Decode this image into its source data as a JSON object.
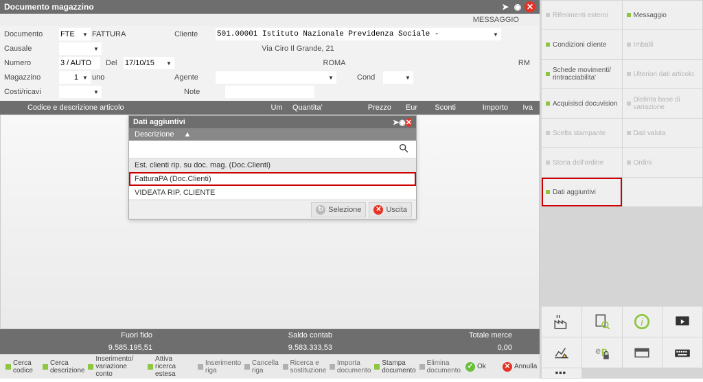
{
  "title": "Documento magazzino",
  "msg_label": "MESSAGGIO",
  "form": {
    "documento_lbl": "Documento",
    "documento_val": "FTE",
    "documento_desc": "FATTURA",
    "cliente_lbl": "Cliente",
    "cliente_val": "501.00001 Istituto Nazionale Previdenza Sociale -",
    "address": "Via Ciro Il Grande, 21",
    "city": "ROMA",
    "prov": "RM",
    "causale_lbl": "Causale",
    "numero_lbl": "Numero",
    "numero_val": "3 / AUTO",
    "del_lbl": "Del",
    "del_val": "17/10/15",
    "magazzino_lbl": "Magazzino",
    "magazzino_val": "1",
    "magazzino_desc": "uno",
    "agente_lbl": "Agente",
    "cond_lbl": "Cond",
    "costi_lbl": "Costi/ricavi",
    "note_lbl": "Note"
  },
  "grid_headers": {
    "codice": "Codice e descrizione articolo",
    "um": "Um",
    "qta": "Quantita'",
    "prezzo": "Prezzo",
    "eur": "Eur",
    "sconti": "Sconti",
    "importo": "Importo",
    "iva": "Iva"
  },
  "dialog": {
    "title": "Dati aggiuntivi",
    "col": "Descrizione",
    "items": [
      "Est. clienti rip. su doc. mag. (Doc.Clienti)",
      "FatturaPA (Doc.Clienti)",
      "VIDEATA RIP. CLIENTE"
    ],
    "sel": "Selezione",
    "exit": "Uscita"
  },
  "totals": {
    "fuori": "Fuori fido",
    "saldo": "Saldo contab",
    "totale": "Totale merce",
    "v1": "9.585.195,51",
    "v2": "9.583.333,53",
    "v3": "0,00"
  },
  "footer": [
    {
      "t": "Cerca\ncodice",
      "on": true
    },
    {
      "t": "Cerca\ndescrizione",
      "on": true
    },
    {
      "t": "Inserimento/\nvariazione conto",
      "on": true
    },
    {
      "t": "Attiva ricerca\nestesa",
      "on": true
    },
    {
      "t": "Inserimento\nriga",
      "on": false
    },
    {
      "t": "Cancella\nriga",
      "on": false
    },
    {
      "t": "Ricerca e\nsostituzione",
      "on": false
    },
    {
      "t": "Importa\ndocumento",
      "on": false
    },
    {
      "t": "Stampa\ndocumento",
      "on": true
    },
    {
      "t": "Elimina\ndocumento",
      "on": false
    }
  ],
  "footer_ok": "Ok",
  "footer_cancel": "Annulla",
  "side": [
    {
      "t": "Riferimenti esterni",
      "a": false
    },
    {
      "t": "Messaggio",
      "a": true
    },
    {
      "t": "Condizioni cliente",
      "a": true
    },
    {
      "t": "Imballi",
      "a": false
    },
    {
      "t": "Schede movimenti/\nrintracciabilita'",
      "a": true
    },
    {
      "t": "Ulteriori dati articolo",
      "a": false
    },
    {
      "t": "Acquisisci docuvision",
      "a": true
    },
    {
      "t": "Distinta base di variazione",
      "a": false
    },
    {
      "t": "Scelta stampante",
      "a": false
    },
    {
      "t": "Dati valuta",
      "a": false
    },
    {
      "t": "Storia dell'ordine",
      "a": false
    },
    {
      "t": "Ordini",
      "a": false
    },
    {
      "t": "Dati aggiuntivi",
      "a": true,
      "hl": true
    },
    {
      "t": "",
      "a": false
    }
  ]
}
